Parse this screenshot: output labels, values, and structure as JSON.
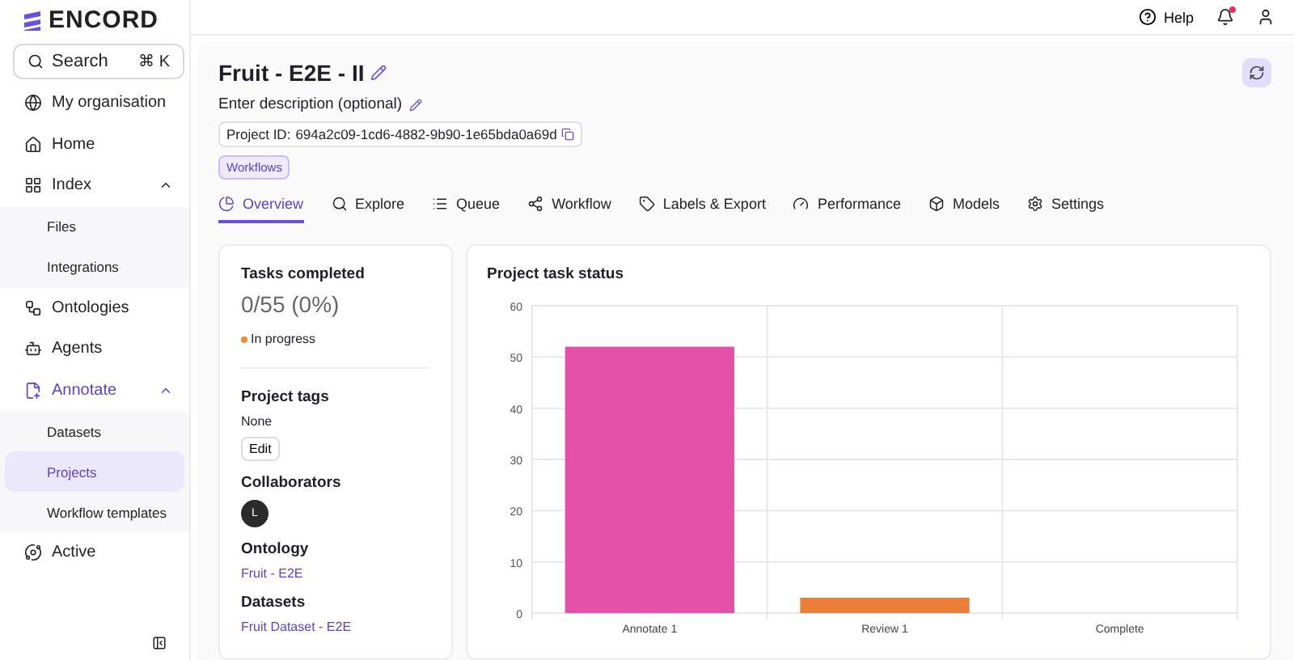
{
  "brand": {
    "name": "ENCORD"
  },
  "search": {
    "label": "Search",
    "shortcut": "⌘ K"
  },
  "sidebar": {
    "items": [
      {
        "kind": "item",
        "label": "My organisation",
        "selected": false
      },
      {
        "kind": "item",
        "label": "Home",
        "selected": false
      },
      {
        "kind": "group",
        "label": "Index",
        "selected": false,
        "expanded": true,
        "children": [
          {
            "label": "Files",
            "selected": false
          },
          {
            "label": "Integrations",
            "selected": false
          }
        ]
      },
      {
        "kind": "item",
        "label": "Ontologies",
        "selected": false
      },
      {
        "kind": "item",
        "label": "Agents",
        "selected": false
      },
      {
        "kind": "group",
        "label": "Annotate",
        "selected": true,
        "expanded": true,
        "children": [
          {
            "label": "Datasets",
            "selected": false
          },
          {
            "label": "Projects",
            "selected": true
          },
          {
            "label": "Workflow templates",
            "selected": false
          }
        ]
      },
      {
        "kind": "item",
        "label": "Active",
        "selected": false
      }
    ]
  },
  "topbar": {
    "help": "Help",
    "has_notification": true
  },
  "project": {
    "title": "Fruit - E2E - II",
    "description": "Enter description (optional)",
    "id_label": "Project ID:",
    "id": "694a2c09-1cd6-4882-9b90-1e65bda0a69d",
    "badge": "Workflows"
  },
  "tabs": [
    {
      "label": "Overview",
      "selected": true
    },
    {
      "label": "Explore",
      "selected": false
    },
    {
      "label": "Queue",
      "selected": false
    },
    {
      "label": "Workflow",
      "selected": false
    },
    {
      "label": "Labels & Export",
      "selected": false
    },
    {
      "label": "Performance",
      "selected": false
    },
    {
      "label": "Models",
      "selected": false
    },
    {
      "label": "Settings",
      "selected": false
    }
  ],
  "summary": {
    "tasks_title": "Tasks completed",
    "tasks_value": "0/55 (0%)",
    "status": "In progress",
    "tags_title": "Project tags",
    "tags_value": "None",
    "edit": "Edit",
    "collaborators_title": "Collaborators",
    "collaborators": [
      "L"
    ],
    "ontology_title": "Ontology",
    "ontology": "Fruit - E2E",
    "datasets_title": "Datasets",
    "datasets": "Fruit Dataset - E2E"
  },
  "chart_panel": {
    "title": "Project task status",
    "chart_data": {
      "type": "bar",
      "categories": [
        "Annotate 1",
        "Review 1",
        "Complete"
      ],
      "values": [
        52,
        3,
        0
      ],
      "grid": true,
      "ylim": [
        0,
        60
      ],
      "yticks": [
        0,
        10,
        20,
        30,
        40,
        50,
        60
      ]
    }
  }
}
